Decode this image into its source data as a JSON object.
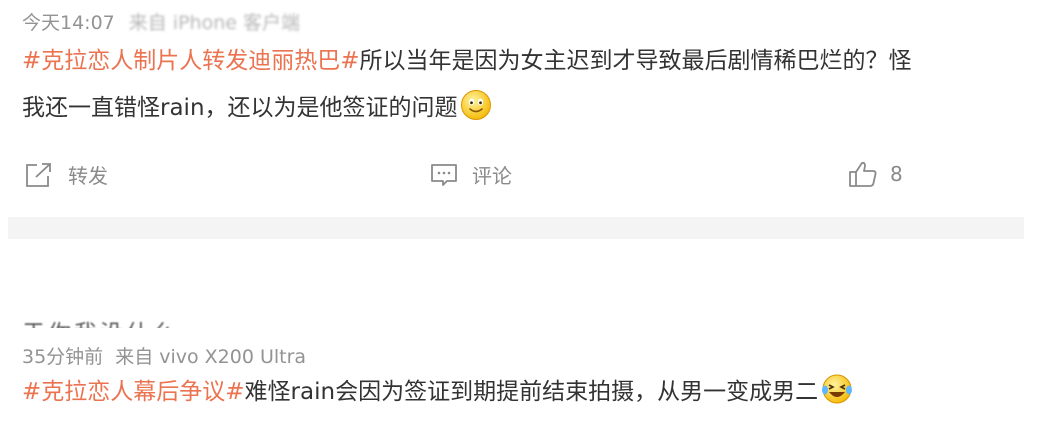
{
  "post1": {
    "time": "今天14:07",
    "source_obscured": "来自 iPhone 客户端",
    "hashtag": "#克拉恋人制片人转发迪丽热巴#",
    "line1_rest": "所以当年是因为女主迟到才导致最后剧情稀巴烂的？怪",
    "line2": "我还一直错怪rain，还以为是他签证的问题",
    "actions": {
      "repost": "转发",
      "comment": "评论",
      "like_count": "8"
    }
  },
  "post2": {
    "cut_text": "于你我没什么",
    "time": "35分钟前",
    "source": "来自 vivo X200 Ultra",
    "hashtag": "#克拉恋人幕后争议#",
    "text_rest": "难怪rain会因为签证到期提前结束拍摄，从男一变成男二"
  },
  "icons": {
    "smile": "smile-emoji-icon",
    "laugh": "laugh-cry-emoji-icon",
    "repost": "share-icon",
    "comment": "comment-icon",
    "like": "thumbs-up-icon"
  },
  "colors": {
    "hashtag": "#eb7350",
    "meta": "#939393",
    "text": "#333333",
    "divider": "#f4f4f4"
  }
}
